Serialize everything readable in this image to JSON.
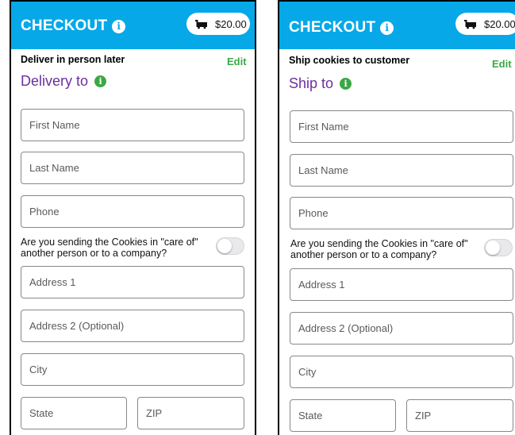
{
  "colors": {
    "brand": "#06a8e8",
    "purple": "#6b2fa0",
    "green": "#3aa845"
  },
  "screens": [
    {
      "header_title": "CHECKOUT",
      "cart_total": "$20.00",
      "method_label": "Deliver in person later",
      "edit_label": "Edit",
      "section_title": "Delivery to",
      "fields": {
        "first_name": "First Name",
        "last_name": "Last Name",
        "phone": "Phone",
        "address1": "Address 1",
        "address2": "Address 2 (Optional)",
        "city": "City",
        "state": "State",
        "zip": "ZIP"
      },
      "care_of_question": "Are you sending the Cookies in \"care of\" another person or to a company?"
    },
    {
      "header_title": "CHECKOUT",
      "cart_total": "$20.00",
      "method_label": "Ship cookies to customer",
      "edit_label": "Edit",
      "section_title": "Ship to",
      "fields": {
        "first_name": "First Name",
        "last_name": "Last Name",
        "phone": "Phone",
        "address1": "Address 1",
        "address2": "Address 2 (Optional)",
        "city": "City",
        "state": "State",
        "zip": "ZIP"
      },
      "care_of_question": "Are you sending the Cookies in \"care of\" another person or to a company?"
    }
  ]
}
